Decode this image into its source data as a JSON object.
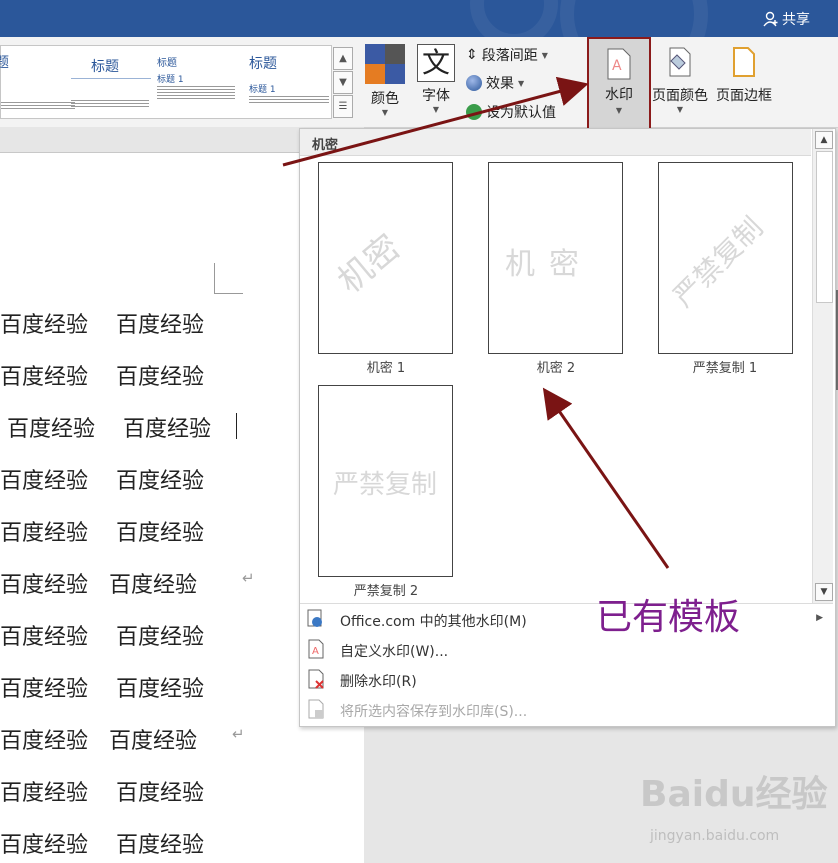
{
  "header": {
    "share_label": "共享"
  },
  "styles_gallery": {
    "items": [
      {
        "title": "题"
      },
      {
        "title": "标题",
        "subtitle": ""
      },
      {
        "title": "标题",
        "subtitle": "标题 1"
      },
      {
        "title": "标题",
        "subtitle": "标题 1"
      }
    ]
  },
  "ribbon": {
    "colors_label": "颜色",
    "fonts_label": "字体",
    "paragraph_spacing_label": "段落间距",
    "effects_label": "效果",
    "set_default_label": "设为默认值",
    "watermark_label": "水印",
    "page_color_label": "页面颜色",
    "page_borders_label": "页面边框"
  },
  "document": {
    "lines": [
      "百度经验    百度经验",
      "百度经验    百度经验",
      " 百度经验    百度经验",
      "百度经验    百度经验",
      "百度经验    百度经验",
      "百度经验   百度经验",
      "百度经验    百度经验",
      "百度经验    百度经验",
      "百度经验   百度经验",
      "百度经验    百度经验",
      "百度经验    百度经验"
    ]
  },
  "watermark_menu": {
    "section_title": "机密",
    "thumbnails": [
      {
        "caption": "机密 1",
        "watermark_text": "机密"
      },
      {
        "caption": "机密 2",
        "watermark_text": "机密"
      },
      {
        "caption": "严禁复制 1",
        "watermark_text": "严禁复制"
      },
      {
        "caption": "严禁复制 2",
        "watermark_text": "严禁复制"
      }
    ],
    "items": [
      {
        "label": "Office.com 中的其他水印(M)",
        "enabled": true
      },
      {
        "label": "自定义水印(W)...",
        "enabled": true
      },
      {
        "label": "删除水印(R)",
        "enabled": true
      },
      {
        "label": "将所选内容保存到水印库(S)...",
        "enabled": false
      }
    ]
  },
  "annotation": {
    "text": "已有模板",
    "color": "#7e1f8e",
    "arrow_color": "#7a1414"
  },
  "watermark_logo": {
    "brand": "Baidu经验",
    "url_text": "jingyan.baidu.com"
  },
  "colors": {
    "titlebar": "#2b579a",
    "highlight_border": "#8b1a1a"
  }
}
